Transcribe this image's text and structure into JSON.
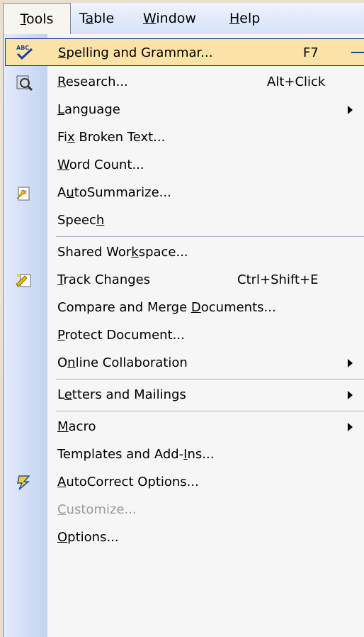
{
  "menubar": {
    "tools": {
      "pre": "",
      "u": "T",
      "post": "ools"
    },
    "table": {
      "pre": "T",
      "u": "a",
      "post": "ble"
    },
    "window": {
      "pre": "",
      "u": "W",
      "post": "indow"
    },
    "help": {
      "pre": "",
      "u": "H",
      "post": "elp"
    }
  },
  "menu": {
    "items": [
      {
        "pre": "",
        "u": "S",
        "post": "pelling and Grammar...",
        "shortcut": "F7",
        "icon": "spellcheck-icon"
      },
      {
        "pre": "",
        "u": "R",
        "post": "esearch...",
        "shortcut": "Alt+Click",
        "icon": "research-icon"
      },
      {
        "pre": "",
        "u": "L",
        "post": "anguage",
        "submenu": true
      },
      {
        "pre": "Fi",
        "u": "x",
        "post": " Broken Text..."
      },
      {
        "pre": "",
        "u": "W",
        "post": "ord Count..."
      },
      {
        "pre": "A",
        "u": "u",
        "post": "toSummarize...",
        "icon": "autosummarize-icon"
      },
      {
        "pre": "Speec",
        "u": "h",
        "post": ""
      },
      {
        "pre": "Shared Wor",
        "u": "k",
        "post": "space..."
      },
      {
        "pre": "",
        "u": "T",
        "post": "rack Changes",
        "shortcut": "Ctrl+Shift+E",
        "icon": "track-changes-icon"
      },
      {
        "pre": "Compare and Merge ",
        "u": "D",
        "post": "ocuments..."
      },
      {
        "pre": "",
        "u": "P",
        "post": "rotect Document..."
      },
      {
        "pre": "O",
        "u": "n",
        "post": "line Collaboration",
        "submenu": true
      },
      {
        "pre": "L",
        "u": "e",
        "post": "tters and Mailings",
        "submenu": true
      },
      {
        "pre": "",
        "u": "M",
        "post": "acro",
        "submenu": true
      },
      {
        "pre": "Templates and Add-",
        "u": "I",
        "post": "ns..."
      },
      {
        "pre": "",
        "u": "A",
        "post": "utoCorrect Options...",
        "icon": "autocorrect-icon"
      },
      {
        "pre": "",
        "u": "C",
        "post": "ustomize...",
        "disabled": true
      },
      {
        "pre": "",
        "u": "O",
        "post": "ptions..."
      }
    ]
  }
}
